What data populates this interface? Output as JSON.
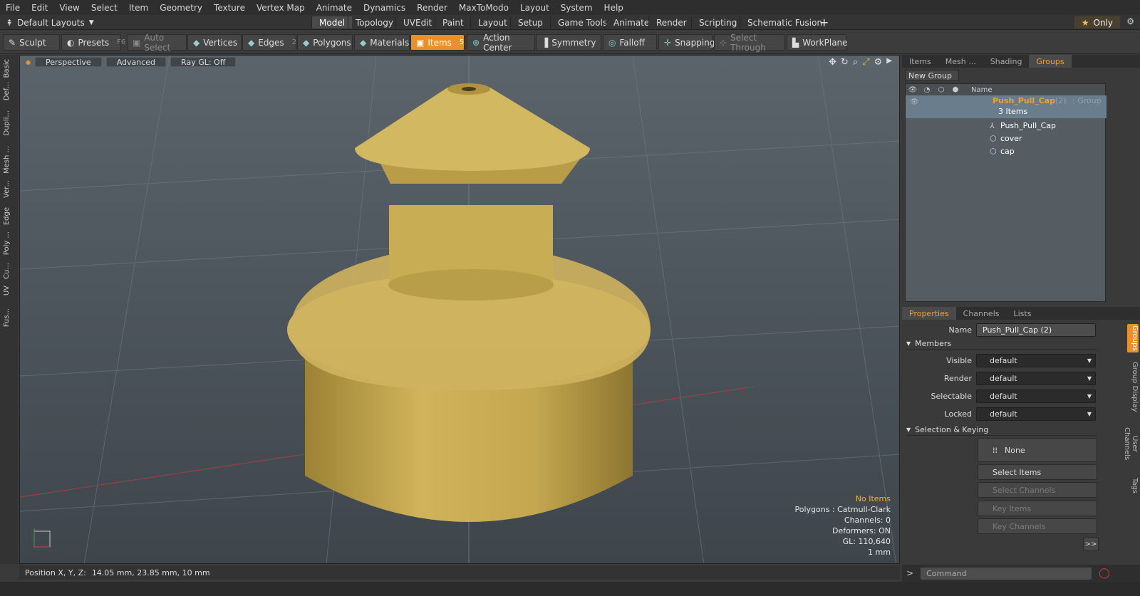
{
  "menu": [
    "File",
    "Edit",
    "View",
    "Select",
    "Item",
    "Geometry",
    "Texture",
    "Vertex Map",
    "Animate",
    "Dynamics",
    "Render",
    "MaxToModo",
    "Layout",
    "System",
    "Help"
  ],
  "layout_tabs": {
    "selector": "Default Layouts",
    "tabs": [
      "Model",
      "Topology",
      "UVEdit",
      "Paint",
      "Layout",
      "Setup",
      "Game Tools",
      "Animate",
      "Render",
      "Scripting",
      "Schematic Fusion"
    ],
    "active": "Model",
    "only_label": "Only"
  },
  "toolbar": {
    "sculpt": "Sculpt",
    "presets": "Presets",
    "presets_key": "F6",
    "auto_select": "Auto Select",
    "vertices": "Vertices",
    "vertices_key": "1",
    "edges": "Edges",
    "edges_key": "2",
    "polygons": "Polygons",
    "polygons_key": "3",
    "materials": "Materials",
    "items": "Items",
    "items_key": "5",
    "action_center": "Action Center",
    "symmetry": "Symmetry",
    "falloff": "Falloff",
    "snapping": "Snapping",
    "select_through": "Select Through",
    "workplane": "WorkPlane"
  },
  "left_tabs": [
    "Basic",
    "Def...",
    "Dupli...",
    "Mesh ...",
    "Ver...",
    "Edge",
    "Poly ...",
    "Cu...",
    "UV",
    "Fus..."
  ],
  "viewport": {
    "view": "Perspective",
    "mode": "Advanced",
    "raygl": "Ray GL: Off",
    "info": {
      "selection": "No Items",
      "polygons": "Polygons : Catmull-Clark",
      "channels": "Channels: 0",
      "deformers": "Deformers: ON",
      "gl": "GL: 110,640",
      "scale": "1 mm"
    }
  },
  "status": {
    "label": "Position X, Y, Z:",
    "value": "14.05 mm, 23.85 mm, 10 mm"
  },
  "right_top_tabs": [
    "Items",
    "Mesh ...",
    "Shading",
    "Groups"
  ],
  "right_top_active": "Groups",
  "groups": {
    "new_group": "New Group",
    "name_header": "Name",
    "group_name": "Push_Pull_Cap",
    "group_count": "(2)",
    "group_type": ": Group",
    "items_count": "3 Items",
    "children": [
      "Push_Pull_Cap",
      "cover",
      "cap"
    ]
  },
  "props_tabs": [
    "Properties",
    "Channels",
    "Lists"
  ],
  "props_active": "Properties",
  "props": {
    "name_label": "Name",
    "name_value": "Push_Pull_Cap (2)",
    "members_section": "Members",
    "visible_label": "Visible",
    "visible_value": "default",
    "render_label": "Render",
    "render_value": "default",
    "selectable_label": "Selectable",
    "selectable_value": "default",
    "locked_label": "Locked",
    "locked_value": "default",
    "selkey_section": "Selection & Keying",
    "none_btn": "None",
    "select_items": "Select Items",
    "select_channels": "Select Channels",
    "key_items": "Key Items",
    "key_channels": "Key Channels",
    "more": ">>"
  },
  "right_vtabs": [
    "Groups",
    "Group Display",
    "User Channels",
    "Tags"
  ],
  "command_placeholder": "Command",
  "colors": {
    "accent": "#e8902a",
    "model": "#c9a850",
    "viewport_top": "#5b646b"
  }
}
